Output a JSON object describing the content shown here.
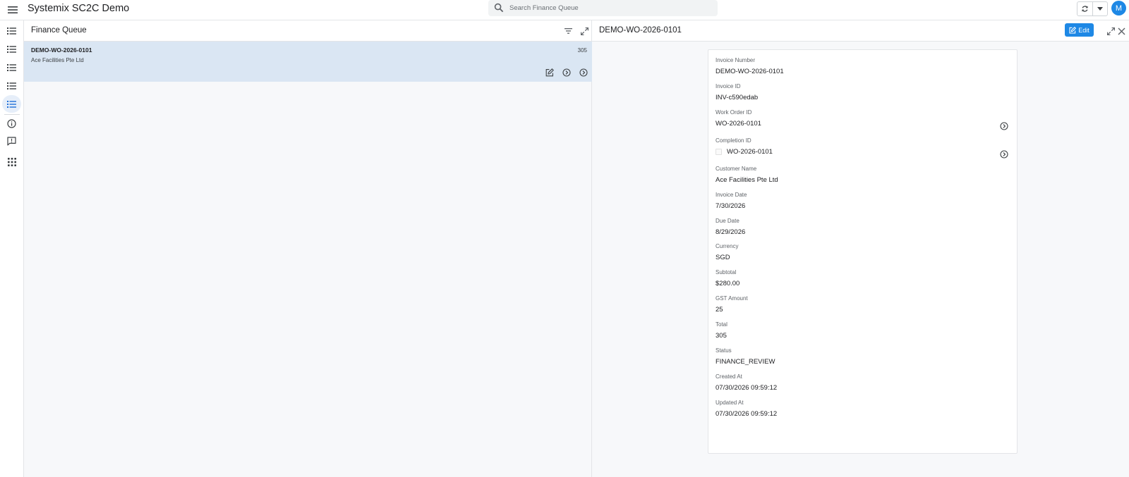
{
  "app": {
    "title": "Systemix SC2C Demo",
    "avatar_initial": "M"
  },
  "search": {
    "placeholder": "Search Finance Queue"
  },
  "icons": {
    "menu": "menu-icon",
    "search": "search-icon",
    "sync": "sync-icon",
    "dropdown": "caret-down-icon",
    "list": "list-icon",
    "info": "info-icon",
    "feedback": "feedback-icon",
    "apps": "apps-grid-icon",
    "filter": "filter-icon",
    "expand": "expand-icon",
    "edit": "edit-icon",
    "open": "chevron-circle-icon",
    "close": "close-icon"
  },
  "colors": {
    "accent": "#1e88e5",
    "selected_row": "#dae6f3",
    "rail_active": "#e6eef9"
  },
  "queue": {
    "title": "Finance Queue",
    "rows": [
      {
        "title": "DEMO-WO-2026-0101",
        "subtitle": "Ace Facilities Pte Ltd",
        "count": "305"
      }
    ]
  },
  "detail": {
    "title": "DEMO-WO-2026-0101",
    "edit_label": "Edit",
    "fields": [
      {
        "label": "Invoice Number",
        "value": "DEMO-WO-2026-0101"
      },
      {
        "label": "Invoice ID",
        "value": "INV-c590edab"
      },
      {
        "label": "Work Order ID",
        "value": "WO-2026-0101"
      },
      {
        "label": "Completion ID",
        "value": "WO-2026-0101"
      },
      {
        "label": "Customer Name",
        "value": "Ace Facilities Pte Ltd"
      },
      {
        "label": "Invoice Date",
        "value": "7/30/2026"
      },
      {
        "label": "Due Date",
        "value": "8/29/2026"
      },
      {
        "label": "Currency",
        "value": "SGD"
      },
      {
        "label": "Subtotal",
        "value": "$280.00"
      },
      {
        "label": "GST Amount",
        "value": "25"
      },
      {
        "label": "Total",
        "value": "305"
      },
      {
        "label": "Status",
        "value": "FINANCE_REVIEW"
      },
      {
        "label": "Created At",
        "value": "07/30/2026 09:59:12"
      },
      {
        "label": "Updated At",
        "value": "07/30/2026 09:59:12"
      }
    ]
  }
}
